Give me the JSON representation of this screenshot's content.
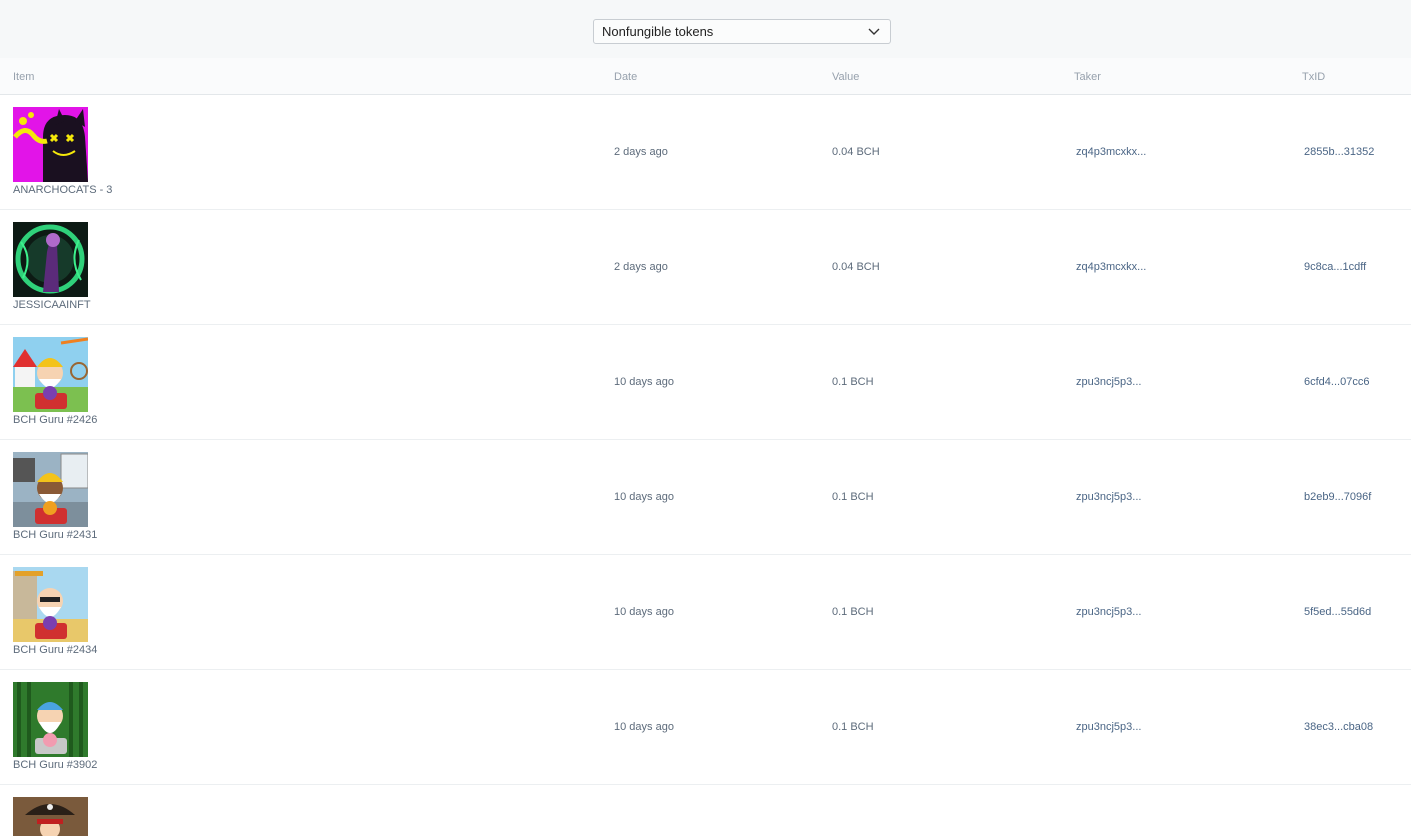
{
  "filter": {
    "selected": "Nonfungible tokens"
  },
  "table": {
    "headers": [
      "Item",
      "Date",
      "Value",
      "Taker",
      "TxID"
    ],
    "rows": [
      {
        "name": "ANARCHOCATS - 3",
        "date": "2 days ago",
        "value": "0.04 BCH",
        "taker": "zq4p3mcxkx...",
        "txid": "2855b...31352"
      },
      {
        "name": "JESSICAAINFT",
        "date": "2 days ago",
        "value": "0.04 BCH",
        "taker": "zq4p3mcxkx...",
        "txid": "9c8ca...1cdff"
      },
      {
        "name": "BCH Guru #2426",
        "date": "10 days ago",
        "value": "0.1 BCH",
        "taker": "zpu3ncj5p3...",
        "txid": "6cfd4...07cc6"
      },
      {
        "name": "BCH Guru #2431",
        "date": "10 days ago",
        "value": "0.1 BCH",
        "taker": "zpu3ncj5p3...",
        "txid": "b2eb9...7096f"
      },
      {
        "name": "BCH Guru #2434",
        "date": "10 days ago",
        "value": "0.1 BCH",
        "taker": "zpu3ncj5p3...",
        "txid": "5f5ed...55d6d"
      },
      {
        "name": "BCH Guru #3902",
        "date": "10 days ago",
        "value": "0.1 BCH",
        "taker": "zpu3ncj5p3...",
        "txid": "38ec3...cba08"
      }
    ]
  }
}
